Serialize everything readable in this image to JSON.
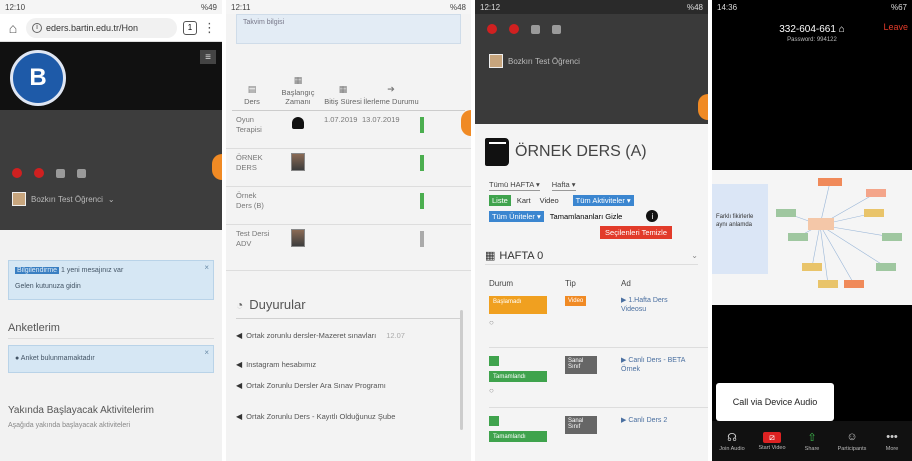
{
  "panel1": {
    "status": {
      "time": "12:10",
      "right": "%49"
    },
    "url": "eders.bartin.edu.tr/Hon",
    "tab_count": "1",
    "logo_text": "B",
    "user_label": "Bozkırı Test Öğrenci",
    "notice_highlight": "Bilgilendirme",
    "notice_text": "1 yeni mesajınız var",
    "notice_link": "Gelen kutunuza gidin",
    "surveys_title": "Anketlerim",
    "surveys_empty": "Anket bulunmamaktadır",
    "upcoming_title": "Yakında Başlayacak Aktivitelerim",
    "upcoming_sub": "Aşağıda yakında başlayacak aktiviteleri"
  },
  "panel2": {
    "status": {
      "time": "12:11",
      "right": "%48"
    },
    "top_card_text": "Takvim bilgisi",
    "headers": {
      "course": "Ders",
      "start": "Başlangıç Zamanı",
      "duration": "Bitiş Süresi",
      "status": "İlerleme Durumu"
    },
    "rows": [
      {
        "course": "Oyun Terapisi",
        "start": "1.07.2019",
        "end": "13.07.2019"
      },
      {
        "course": "ÖRNEK DERS",
        "start": "",
        "end": ""
      },
      {
        "course": "Örnek Ders (B)",
        "start": "",
        "end": ""
      },
      {
        "course": "Test Dersi ADV",
        "start": "",
        "end": ""
      }
    ],
    "announcements_title": "Duyurular",
    "announcements": [
      {
        "title": "Ortak zorunlu dersler-Mazeret sınavları",
        "meta": "12.07"
      },
      {
        "title": "Instagram hesabımız",
        "meta": ""
      },
      {
        "title": "Ortak Zorunlu Dersler Ara Sınav Programı",
        "meta": ""
      },
      {
        "title": "Ortak Zorunlu Ders - Kayıtlı Olduğunuz Şube",
        "meta": ""
      }
    ]
  },
  "panel3": {
    "status": {
      "time": "12:12",
      "right": "%48"
    },
    "user_label": "Bozkırı Test Öğrenci",
    "course_title": "ÖRNEK DERS (A)",
    "filters": {
      "week_select": "Tümü HAFTA",
      "week_select2": "Hafta"
    },
    "chips": {
      "list": "Liste",
      "card": "Kart",
      "video": "Video",
      "all_activities": "Tüm Aktiviteler"
    },
    "chips2": {
      "all_units": "Tüm Üniteler",
      "hide_completed": "Tamamlananları Gizle",
      "clear_selected": "Seçilenleri Temizle"
    },
    "week_label": "HAFTA 0",
    "columns": {
      "status": "Durum",
      "type": "Tip",
      "name": "Ad"
    },
    "activities": [
      {
        "status": "Başlamadı",
        "type": "Video",
        "name": "1.Hafta Ders Videosu"
      },
      {
        "status": "Tamamlandı",
        "type": "Sanal Sınıf",
        "name": "Canlı Ders - BETA Örnek"
      },
      {
        "status": "Tamamlandı",
        "type": "Sanal Sınıf",
        "name": "Canlı Ders 2"
      }
    ]
  },
  "panel4": {
    "status": {
      "time": "14:36",
      "right": "%67"
    },
    "meeting_id": "332-604-661",
    "leave_label": "Leave",
    "passcode": "Password: 994122",
    "shared_text": "Farklı fikirlerle aynı anlamda",
    "tooltip": "Call via Device Audio",
    "toolbar": [
      {
        "label": "Join Audio"
      },
      {
        "label": "Start Video"
      },
      {
        "label": "Share"
      },
      {
        "label": "Participants"
      },
      {
        "label": "More"
      }
    ]
  },
  "colors": {
    "accent_orange": "#f08a24",
    "status_green": "#3fa34d",
    "chip_blue": "#3b86d0",
    "danger_red": "#e23b2a"
  }
}
